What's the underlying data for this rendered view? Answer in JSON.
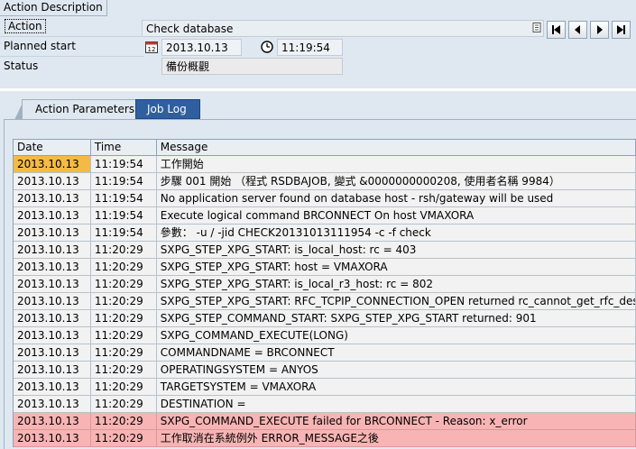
{
  "window": {
    "frame_title": "Action Description"
  },
  "header": {
    "action_label": "Action",
    "action_value": "Check database",
    "planned_start_label": "Planned start",
    "planned_start_date": "2013.10.13",
    "planned_start_time": "11:19:54",
    "status_label": "Status",
    "status_value": "備份概觀",
    "nav_buttons": [
      "first-page-icon",
      "previous-page-icon",
      "next-page-icon",
      "last-page-icon"
    ]
  },
  "tabs": [
    {
      "label": "Action Parameters",
      "active": false
    },
    {
      "label": "Job Log",
      "active": true
    }
  ],
  "job_log": {
    "columns": [
      "Date",
      "Time",
      "Message"
    ],
    "rows": [
      {
        "date": "2013.10.13",
        "time": "11:19:54",
        "message": "工作開始",
        "type": "normal"
      },
      {
        "date": "2013.10.13",
        "time": "11:19:54",
        "message": "步驟 001 開始 （程式 RSDBAJOB, 變式 &0000000000208, 使用者名稱 9984）",
        "type": "normal"
      },
      {
        "date": "2013.10.13",
        "time": "11:19:54",
        "message": "No application server found on database host - rsh/gateway will be used",
        "type": "normal"
      },
      {
        "date": "2013.10.13",
        "time": "11:19:54",
        "message": "Execute logical command BRCONNECT On host VMAXORA",
        "type": "normal"
      },
      {
        "date": "2013.10.13",
        "time": "11:19:54",
        "message": "參數： -u / -jid CHECK20131013111954 -c -f check",
        "type": "normal"
      },
      {
        "date": "2013.10.13",
        "time": "11:20:29",
        "message": "SXPG_STEP_XPG_START: is_local_host: rc = 403",
        "type": "normal"
      },
      {
        "date": "2013.10.13",
        "time": "11:20:29",
        "message": "SXPG_STEP_XPG_START: host = VMAXORA",
        "type": "normal"
      },
      {
        "date": "2013.10.13",
        "time": "11:20:29",
        "message": "SXPG_STEP_XPG_START: is_local_r3_host: rc = 802",
        "type": "normal"
      },
      {
        "date": "2013.10.13",
        "time": "11:20:29",
        "message": "SXPG_STEP_XPG_START: RFC_TCPIP_CONNECTION_OPEN returned rc_cannot_get_rfc_dests",
        "type": "normal"
      },
      {
        "date": "2013.10.13",
        "time": "11:20:29",
        "message": "SXPG_STEP_COMMAND_START: SXPG_STEP_XPG_START returned: 901",
        "type": "normal"
      },
      {
        "date": "2013.10.13",
        "time": "11:20:29",
        "message": "SXPG_COMMAND_EXECUTE(LONG)",
        "type": "normal"
      },
      {
        "date": "2013.10.13",
        "time": "11:20:29",
        "message": "COMMANDNAME = BRCONNECT",
        "type": "normal"
      },
      {
        "date": "2013.10.13",
        "time": "11:20:29",
        "message": "OPERATINGSYSTEM = ANYOS",
        "type": "normal"
      },
      {
        "date": "2013.10.13",
        "time": "11:20:29",
        "message": "TARGETSYSTEM = VMAXORA",
        "type": "normal"
      },
      {
        "date": "2013.10.13",
        "time": "11:20:29",
        "message": "DESTINATION =",
        "type": "normal"
      },
      {
        "date": "2013.10.13",
        "time": "11:20:29",
        "message": "SXPG_COMMAND_EXECUTE failed for BRCONNECT - Reason: x_error",
        "type": "error"
      },
      {
        "date": "2013.10.13",
        "time": "11:20:29",
        "message": "工作取消在系統例外 ERROR_MESSAGE之後",
        "type": "error"
      }
    ]
  },
  "colors": {
    "active_tab": "#2f5f9e",
    "error_row": "#f8b4b4",
    "selected_cell": "#f5b945",
    "background": "#dfe8f0"
  }
}
